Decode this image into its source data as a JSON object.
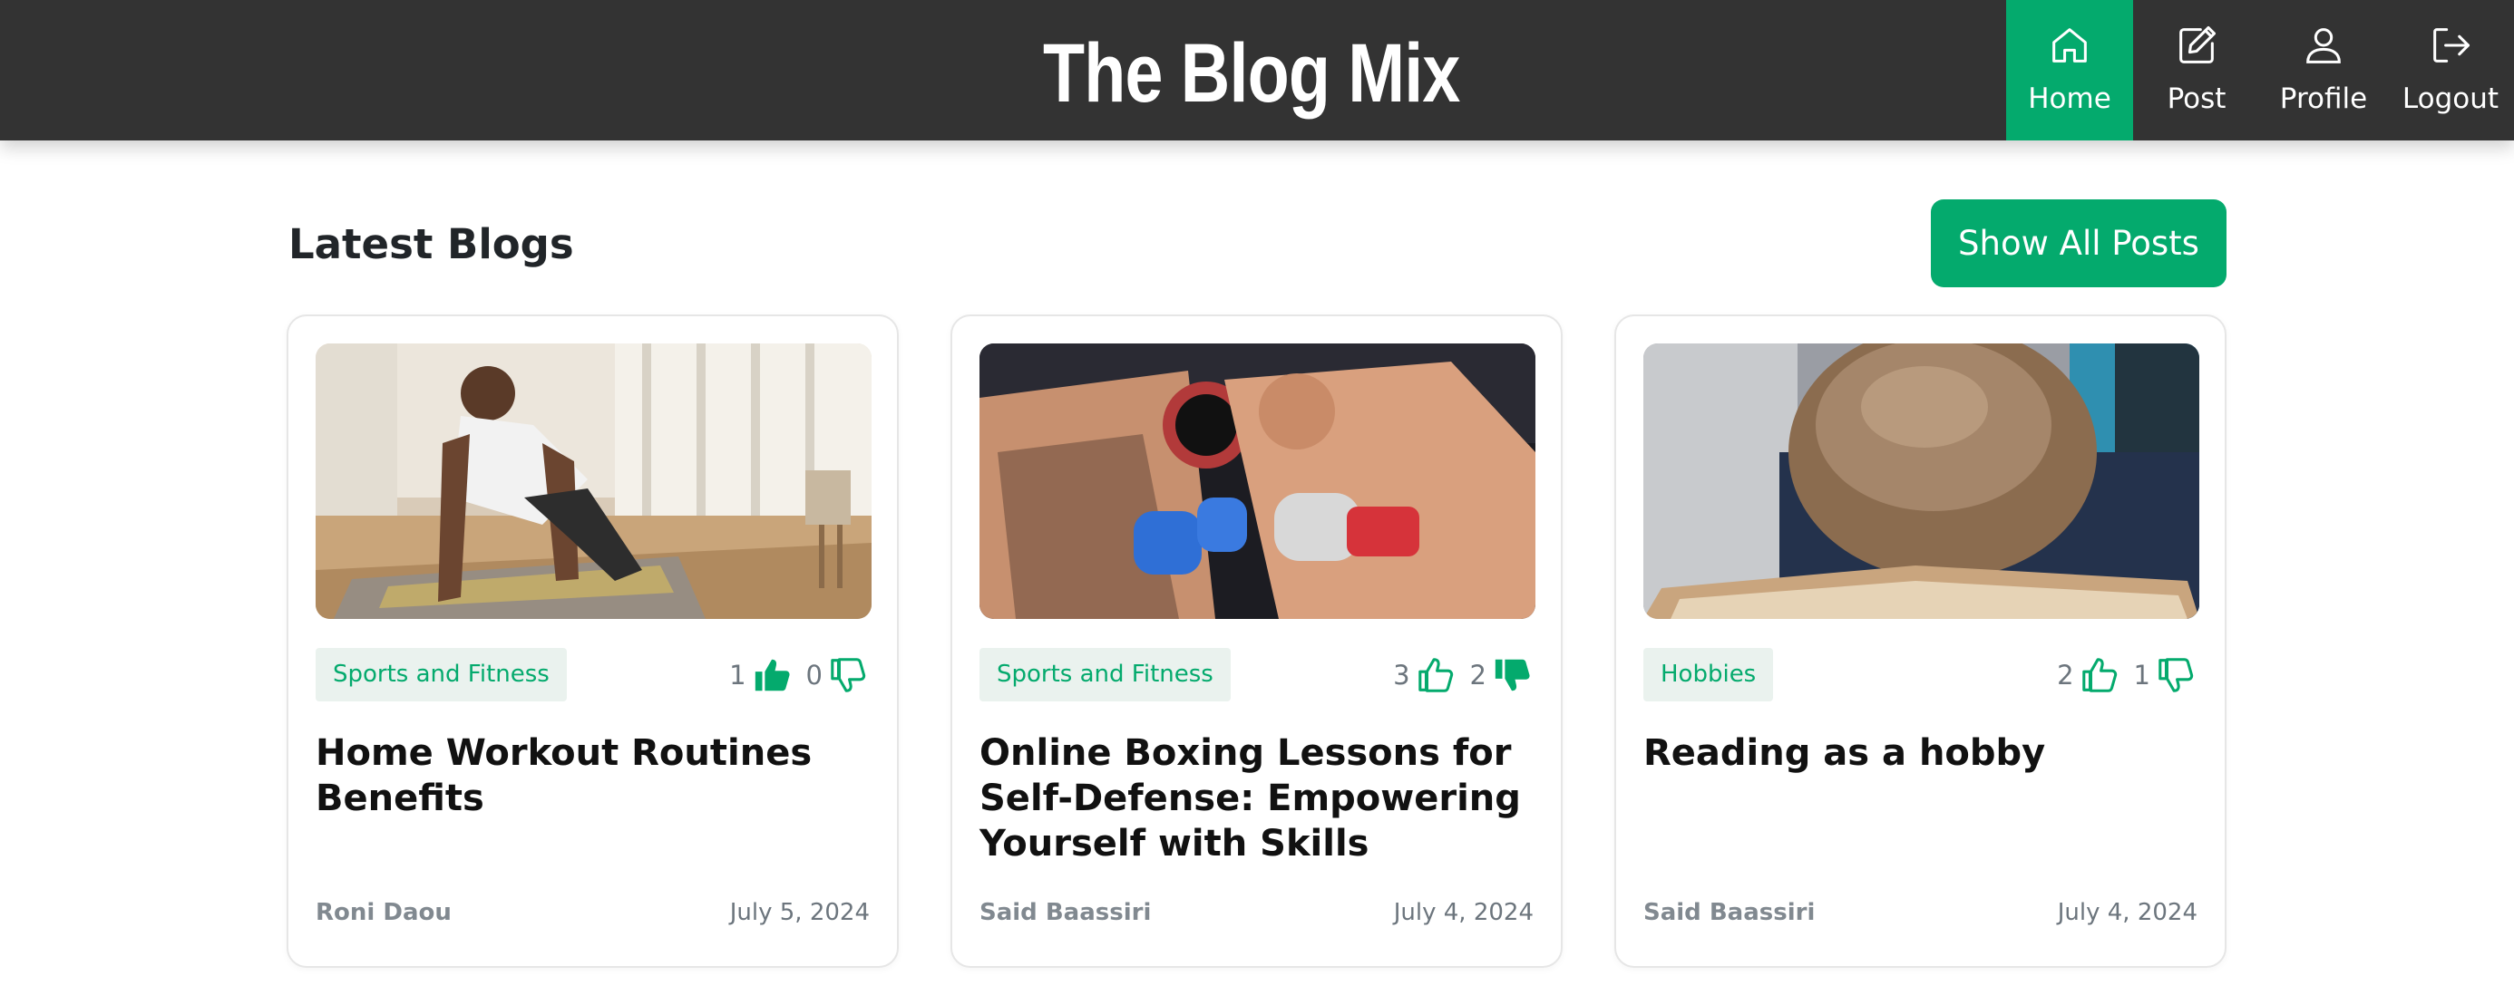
{
  "header": {
    "brand": "The Blog Mix",
    "nav": [
      {
        "label": "Home",
        "icon": "home-icon",
        "active": true
      },
      {
        "label": "Post",
        "icon": "edit-icon",
        "active": false
      },
      {
        "label": "Profile",
        "icon": "user-icon",
        "active": false
      },
      {
        "label": "Logout",
        "icon": "logout-icon",
        "active": false
      }
    ]
  },
  "section": {
    "title": "Latest Blogs",
    "show_all_label": "Show All Posts"
  },
  "posts": [
    {
      "image": "photo of man doing push-up workout at home",
      "category": "Sports and Fitness",
      "likes": "1",
      "dislikes": "0",
      "liked": true,
      "disliked": false,
      "title": "Home Workout Routines Benefits",
      "author": "Roni Daou",
      "date": "July 5, 2024"
    },
    {
      "image": "photo of two boxers in a clinch",
      "category": "Sports and Fitness",
      "likes": "3",
      "dislikes": "2",
      "liked": false,
      "disliked": true,
      "title": "Online Boxing Lessons for Self-Defense: Empowering Yourself with Skills",
      "author": "Said Baassiri",
      "date": "July 4, 2024"
    },
    {
      "image": "photo of child resting head on open book",
      "category": "Hobbies",
      "likes": "2",
      "dislikes": "1",
      "liked": false,
      "disliked": false,
      "title": "Reading as a hobby",
      "author": "Said Baassiri",
      "date": "July 4, 2024"
    }
  ],
  "colors": {
    "accent": "#04aa6d",
    "header_bg": "#333333",
    "tag_bg": "#eaf2ee",
    "muted_text": "#6c757d"
  }
}
